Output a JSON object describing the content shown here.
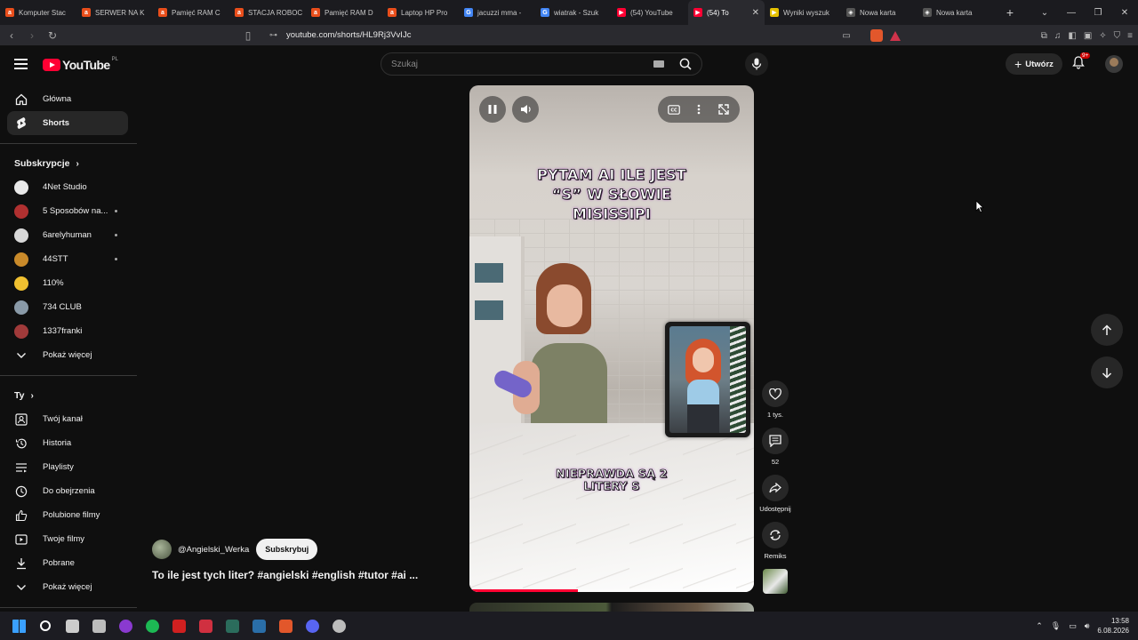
{
  "browser": {
    "tabs": [
      {
        "label": "Komputer Stac",
        "fav_letter": "a",
        "fav_color": "#e94e1b"
      },
      {
        "label": "SERWER NA K",
        "fav_letter": "a",
        "fav_color": "#e94e1b"
      },
      {
        "label": "Pamięć RAM C",
        "fav_letter": "a",
        "fav_color": "#e94e1b"
      },
      {
        "label": "STACJA ROBOC",
        "fav_letter": "a",
        "fav_color": "#e94e1b"
      },
      {
        "label": "Pamięć RAM D",
        "fav_letter": "a",
        "fav_color": "#e94e1b"
      },
      {
        "label": "Laptop HP Pro",
        "fav_letter": "a",
        "fav_color": "#e94e1b"
      },
      {
        "label": "jacuzzi mma -",
        "fav_letter": "G",
        "fav_color": "#4285f4"
      },
      {
        "label": "wiatrak - Szuk",
        "fav_letter": "G",
        "fav_color": "#4285f4"
      },
      {
        "label": "(54) YouTube",
        "fav_letter": "▶",
        "fav_color": "#ff0033"
      },
      {
        "label": "(54) To",
        "fav_letter": "▶",
        "fav_color": "#ff0033",
        "active": true
      },
      {
        "label": "Wyniki wyszuk",
        "fav_letter": "▶",
        "fav_color": "#e5c100"
      },
      {
        "label": "Nowa karta",
        "fav_letter": "◈",
        "fav_color": "#555555"
      },
      {
        "label": "Nowa karta",
        "fav_letter": "◈",
        "fav_color": "#555555"
      }
    ],
    "new_tab": "+",
    "url": "youtube.com/shorts/HL9Rj3VvIJc"
  },
  "header": {
    "logo_text": "YouTube",
    "logo_region": "PL",
    "search_placeholder": "Szukaj",
    "create_label": "Utwórz",
    "notifications_badge": "9+"
  },
  "sidebar": {
    "main": [
      {
        "label": "Główna",
        "icon": "home-icon"
      },
      {
        "label": "Shorts",
        "icon": "shorts-icon",
        "active": true
      }
    ],
    "subscriptions_title": "Subskrypcje",
    "subscriptions": [
      {
        "label": "4Net Studio",
        "color": "#e8e8e8",
        "dot": false
      },
      {
        "label": "5 Sposobów na...",
        "color": "#b03030",
        "dot": true
      },
      {
        "label": "6arelyhuman",
        "color": "#d8d8d8",
        "dot": true
      },
      {
        "label": "44STT",
        "color": "#c98a2a",
        "dot": true
      },
      {
        "label": "110%",
        "color": "#f0c030",
        "dot": false
      },
      {
        "label": "734 CLUB",
        "color": "#8a9aa8",
        "dot": false
      },
      {
        "label": "1337franki",
        "color": "#a03a3a",
        "dot": false
      }
    ],
    "show_more_1": "Pokaż więcej",
    "you_title": "Ty",
    "you": [
      {
        "label": "Twój kanał",
        "icon": "your-channel-icon"
      },
      {
        "label": "Historia",
        "icon": "history-icon"
      },
      {
        "label": "Playlisty",
        "icon": "playlists-icon"
      },
      {
        "label": "Do obejrzenia",
        "icon": "watch-later-icon"
      },
      {
        "label": "Polubione filmy",
        "icon": "liked-icon"
      },
      {
        "label": "Twoje filmy",
        "icon": "your-videos-icon"
      },
      {
        "label": "Pobrane",
        "icon": "downloads-icon"
      }
    ],
    "show_more_2": "Pokaż więcej"
  },
  "player": {
    "caption_top": "PYTAM AI ILE JEST\n“S” W SŁOWIE\nMISISSIPI",
    "caption_bottom": "NIEPRAWDA SĄ 2\nLITERY S",
    "progress": 0.38
  },
  "actions": {
    "likes": "1 tys.",
    "comments": "52",
    "share": "Udostępnij",
    "remix": "Remiks"
  },
  "video": {
    "channel": "@Angielski_Werka",
    "subscribe": "Subskrybuj",
    "title": "To ile jest tych liter? #angielski #english #tutor #ai ..."
  },
  "taskbar": {
    "time": "13:58",
    "date": "6.08.2026",
    "apps": [
      {
        "name": "start-icon",
        "color": "#3aa0ff"
      },
      {
        "name": "search-icon",
        "color": "#ffffff"
      },
      {
        "name": "file-explorer-icon",
        "color": "#cccccc"
      },
      {
        "name": "app-icon",
        "color": "#bcbcbc"
      },
      {
        "name": "app-purple-icon",
        "color": "#8a3ad0"
      },
      {
        "name": "spotify-icon",
        "color": "#1db954"
      },
      {
        "name": "app-red-icon",
        "color": "#d02020"
      },
      {
        "name": "app-red2-icon",
        "color": "#d03040"
      },
      {
        "name": "app-dark-icon",
        "color": "#2b6c5c"
      },
      {
        "name": "steam-icon",
        "color": "#2a6ea8"
      },
      {
        "name": "brave-icon",
        "color": "#e2572b"
      },
      {
        "name": "discord-icon",
        "color": "#5865f2"
      },
      {
        "name": "app-gray-icon",
        "color": "#bcbcbc"
      }
    ]
  }
}
